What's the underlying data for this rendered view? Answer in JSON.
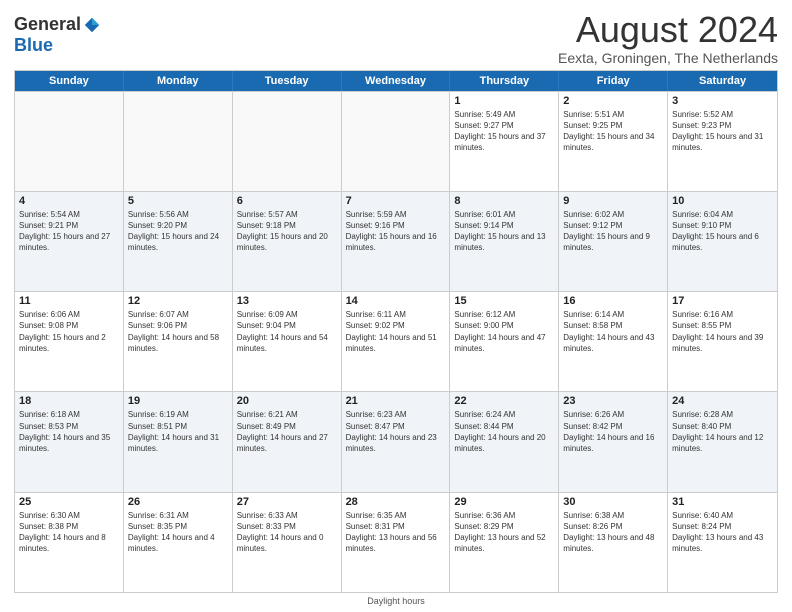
{
  "header": {
    "logo_general": "General",
    "logo_blue": "Blue",
    "main_title": "August 2024",
    "subtitle": "Eexta, Groningen, The Netherlands"
  },
  "calendar": {
    "days_of_week": [
      "Sunday",
      "Monday",
      "Tuesday",
      "Wednesday",
      "Thursday",
      "Friday",
      "Saturday"
    ],
    "weeks": [
      [
        {
          "day": "",
          "info": ""
        },
        {
          "day": "",
          "info": ""
        },
        {
          "day": "",
          "info": ""
        },
        {
          "day": "",
          "info": ""
        },
        {
          "day": "1",
          "info": "Sunrise: 5:49 AM\nSunset: 9:27 PM\nDaylight: 15 hours and 37 minutes."
        },
        {
          "day": "2",
          "info": "Sunrise: 5:51 AM\nSunset: 9:25 PM\nDaylight: 15 hours and 34 minutes."
        },
        {
          "day": "3",
          "info": "Sunrise: 5:52 AM\nSunset: 9:23 PM\nDaylight: 15 hours and 31 minutes."
        }
      ],
      [
        {
          "day": "4",
          "info": "Sunrise: 5:54 AM\nSunset: 9:21 PM\nDaylight: 15 hours and 27 minutes."
        },
        {
          "day": "5",
          "info": "Sunrise: 5:56 AM\nSunset: 9:20 PM\nDaylight: 15 hours and 24 minutes."
        },
        {
          "day": "6",
          "info": "Sunrise: 5:57 AM\nSunset: 9:18 PM\nDaylight: 15 hours and 20 minutes."
        },
        {
          "day": "7",
          "info": "Sunrise: 5:59 AM\nSunset: 9:16 PM\nDaylight: 15 hours and 16 minutes."
        },
        {
          "day": "8",
          "info": "Sunrise: 6:01 AM\nSunset: 9:14 PM\nDaylight: 15 hours and 13 minutes."
        },
        {
          "day": "9",
          "info": "Sunrise: 6:02 AM\nSunset: 9:12 PM\nDaylight: 15 hours and 9 minutes."
        },
        {
          "day": "10",
          "info": "Sunrise: 6:04 AM\nSunset: 9:10 PM\nDaylight: 15 hours and 6 minutes."
        }
      ],
      [
        {
          "day": "11",
          "info": "Sunrise: 6:06 AM\nSunset: 9:08 PM\nDaylight: 15 hours and 2 minutes."
        },
        {
          "day": "12",
          "info": "Sunrise: 6:07 AM\nSunset: 9:06 PM\nDaylight: 14 hours and 58 minutes."
        },
        {
          "day": "13",
          "info": "Sunrise: 6:09 AM\nSunset: 9:04 PM\nDaylight: 14 hours and 54 minutes."
        },
        {
          "day": "14",
          "info": "Sunrise: 6:11 AM\nSunset: 9:02 PM\nDaylight: 14 hours and 51 minutes."
        },
        {
          "day": "15",
          "info": "Sunrise: 6:12 AM\nSunset: 9:00 PM\nDaylight: 14 hours and 47 minutes."
        },
        {
          "day": "16",
          "info": "Sunrise: 6:14 AM\nSunset: 8:58 PM\nDaylight: 14 hours and 43 minutes."
        },
        {
          "day": "17",
          "info": "Sunrise: 6:16 AM\nSunset: 8:55 PM\nDaylight: 14 hours and 39 minutes."
        }
      ],
      [
        {
          "day": "18",
          "info": "Sunrise: 6:18 AM\nSunset: 8:53 PM\nDaylight: 14 hours and 35 minutes."
        },
        {
          "day": "19",
          "info": "Sunrise: 6:19 AM\nSunset: 8:51 PM\nDaylight: 14 hours and 31 minutes."
        },
        {
          "day": "20",
          "info": "Sunrise: 6:21 AM\nSunset: 8:49 PM\nDaylight: 14 hours and 27 minutes."
        },
        {
          "day": "21",
          "info": "Sunrise: 6:23 AM\nSunset: 8:47 PM\nDaylight: 14 hours and 23 minutes."
        },
        {
          "day": "22",
          "info": "Sunrise: 6:24 AM\nSunset: 8:44 PM\nDaylight: 14 hours and 20 minutes."
        },
        {
          "day": "23",
          "info": "Sunrise: 6:26 AM\nSunset: 8:42 PM\nDaylight: 14 hours and 16 minutes."
        },
        {
          "day": "24",
          "info": "Sunrise: 6:28 AM\nSunset: 8:40 PM\nDaylight: 14 hours and 12 minutes."
        }
      ],
      [
        {
          "day": "25",
          "info": "Sunrise: 6:30 AM\nSunset: 8:38 PM\nDaylight: 14 hours and 8 minutes."
        },
        {
          "day": "26",
          "info": "Sunrise: 6:31 AM\nSunset: 8:35 PM\nDaylight: 14 hours and 4 minutes."
        },
        {
          "day": "27",
          "info": "Sunrise: 6:33 AM\nSunset: 8:33 PM\nDaylight: 14 hours and 0 minutes."
        },
        {
          "day": "28",
          "info": "Sunrise: 6:35 AM\nSunset: 8:31 PM\nDaylight: 13 hours and 56 minutes."
        },
        {
          "day": "29",
          "info": "Sunrise: 6:36 AM\nSunset: 8:29 PM\nDaylight: 13 hours and 52 minutes."
        },
        {
          "day": "30",
          "info": "Sunrise: 6:38 AM\nSunset: 8:26 PM\nDaylight: 13 hours and 48 minutes."
        },
        {
          "day": "31",
          "info": "Sunrise: 6:40 AM\nSunset: 8:24 PM\nDaylight: 13 hours and 43 minutes."
        }
      ]
    ]
  },
  "footer": {
    "note": "Daylight hours"
  }
}
